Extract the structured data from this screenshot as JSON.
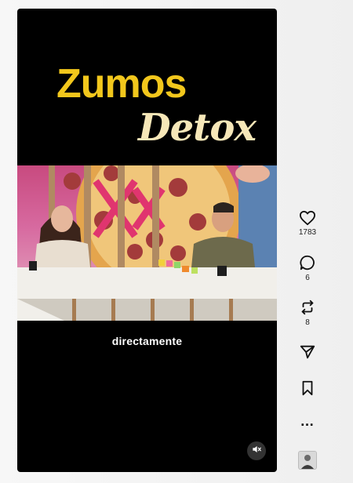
{
  "video": {
    "title_main": "Zumos",
    "title_sub": "Detox",
    "caption": "directamente",
    "mute_icon": "speaker-muted-icon"
  },
  "actions": {
    "like_count": "1783",
    "comment_count": "6",
    "repost_count": "8",
    "share_icon": "send-icon",
    "save_icon": "bookmark-icon",
    "more_label": "…"
  },
  "colors": {
    "title_main": "#f2c71c",
    "title_sub": "#f6e7b8",
    "background": "#000000"
  }
}
